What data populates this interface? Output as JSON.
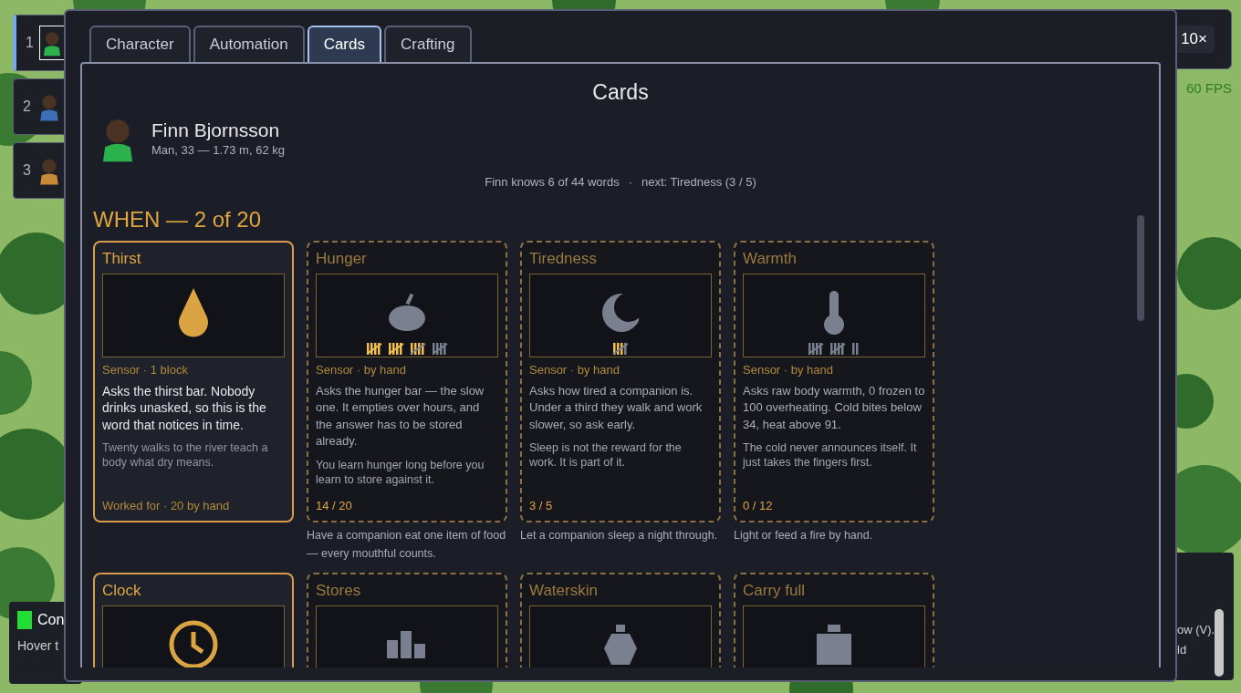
{
  "party": [
    {
      "number": "1",
      "selected": true,
      "color": "#2bb24c"
    },
    {
      "number": "2",
      "selected": false,
      "color": "#3d6fb8"
    },
    {
      "number": "3",
      "selected": false,
      "color": "#c98a3a"
    }
  ],
  "speed": {
    "label": "10×"
  },
  "fps": "60 FPS",
  "tabs": [
    {
      "label": "Character",
      "selected": false
    },
    {
      "label": "Automation",
      "selected": false
    },
    {
      "label": "Cards",
      "selected": true
    },
    {
      "label": "Crafting",
      "selected": false
    }
  ],
  "panel": {
    "title": "Cards",
    "person": {
      "name": "Finn Bjornsson",
      "details": "Man, 33 — 1.73 m, 62 kg",
      "color": "#2bb24c"
    },
    "progress_note": "Finn knows 6 of 44 words",
    "separator": "·",
    "next_note": "next: Tiredness (3 / 5)"
  },
  "section": {
    "heading": "WHEN — 2 of 20",
    "cards": [
      {
        "title": "Thirst",
        "learned": true,
        "meta": "Sensor · 1 block",
        "summary": "Asks the thirst bar. Nobody drinks unasked, so this is the word that notices in time.",
        "flavor": "Twenty walks to the river teach a body what dry means.",
        "footer": "Worked for · 20 by hand"
      },
      {
        "title": "Hunger",
        "learned": false,
        "marks": [
          true,
          true,
          true,
          true,
          true,
          true,
          true,
          true,
          true,
          true,
          true,
          true,
          true,
          true,
          false,
          false,
          false,
          false,
          false,
          false
        ],
        "meta": "Sensor · by hand",
        "summary": "Asks the hunger bar — the slow one. It empties over hours, and the answer has to be stored already.",
        "flavor": "You learn hunger long before you learn to store against it.",
        "footer": "14 / 20",
        "caption": "Have a companion eat one item of food — every mouthful counts."
      },
      {
        "title": "Tiredness",
        "learned": false,
        "marks": [
          true,
          true,
          true,
          false,
          false
        ],
        "meta": "Sensor · by hand",
        "summary": "Asks how tired a companion is. Under a third they walk and work slower, so ask early.",
        "flavor": "Sleep is not the reward for the work. It is part of it.",
        "footer": "3 / 5",
        "caption": "Let a companion sleep a night through."
      },
      {
        "title": "Warmth",
        "learned": false,
        "marks": [
          false,
          false,
          false,
          false,
          false,
          false,
          false,
          false,
          false,
          false,
          false,
          false
        ],
        "meta": "Sensor · by hand",
        "summary": "Asks raw body warmth, 0 frozen to 100 overheating. Cold bites below 34, heat above 91.",
        "flavor": "The cold never announces itself. It just takes the fingers first.",
        "footer": "0 / 12",
        "caption": "Light or feed a fire by hand."
      },
      {
        "title": "Clock",
        "learned": true
      },
      {
        "title": "Stores",
        "learned": false
      },
      {
        "title": "Waterskin",
        "learned": false
      },
      {
        "title": "Carry full",
        "learned": false
      }
    ]
  },
  "side_notes": {
    "left_title": "Con",
    "left_text": "Hover t",
    "right_lines": [
      "ow (V).",
      "ld"
    ]
  }
}
